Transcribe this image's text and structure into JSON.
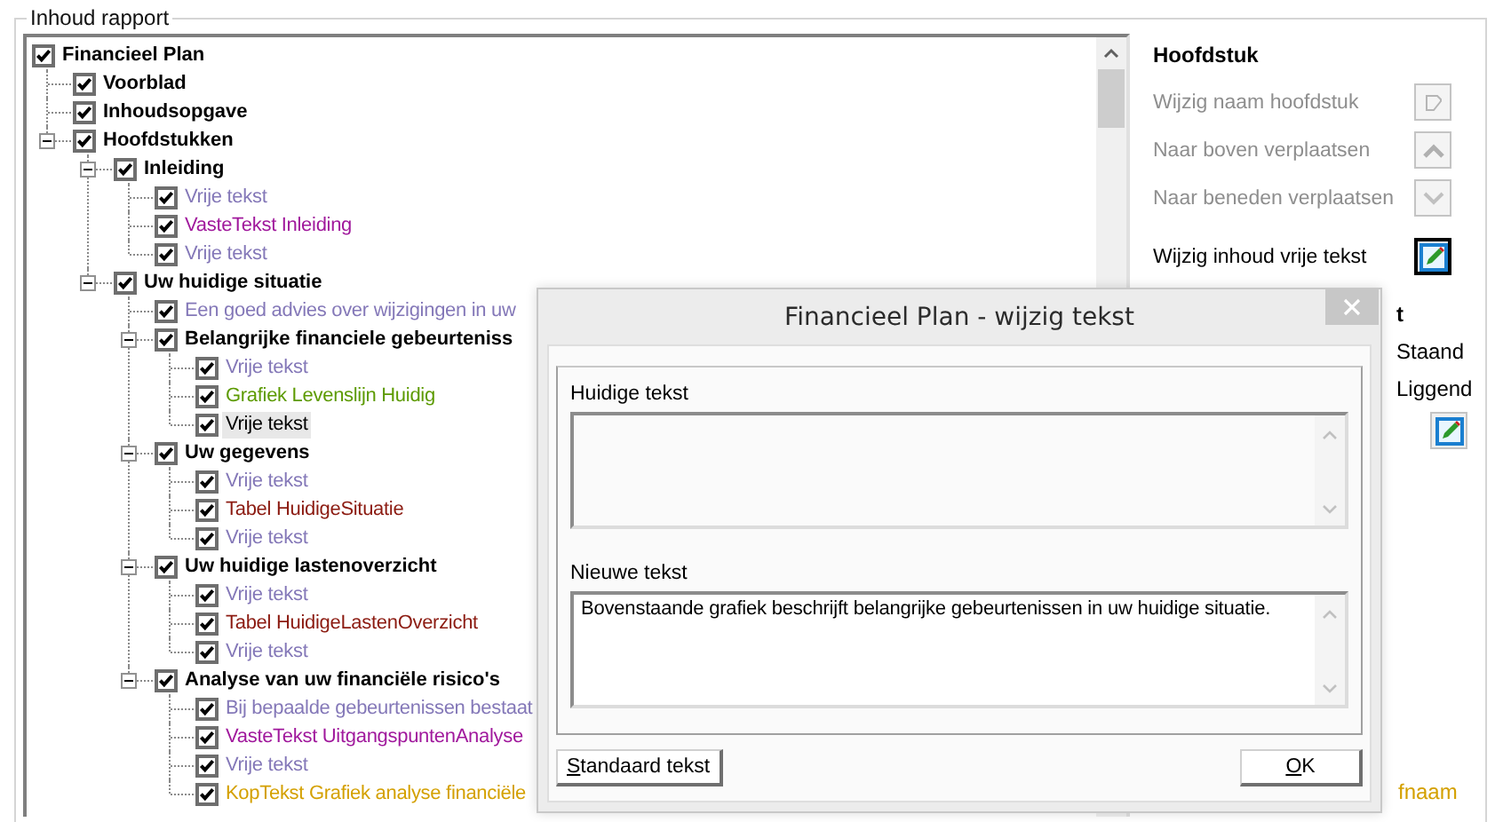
{
  "group_title": "Inhoud rapport",
  "tree": [
    {
      "label": "Financieel Plan",
      "kind": "section",
      "checked": true,
      "selected": false,
      "children": [
        {
          "label": "Voorblad",
          "kind": "section",
          "checked": true,
          "selected": false
        },
        {
          "label": "Inhoudsopgave",
          "kind": "section",
          "checked": true,
          "selected": false
        },
        {
          "label": "Hoofdstukken",
          "kind": "section",
          "checked": true,
          "selected": false,
          "expanded": true,
          "children": [
            {
              "label": "Inleiding",
              "kind": "section",
              "checked": true,
              "selected": false,
              "expanded": true,
              "children": [
                {
                  "label": "Vrije tekst",
                  "kind": "item",
                  "color": "#8478b8",
                  "checked": true,
                  "selected": false
                },
                {
                  "label": "VasteTekst Inleiding",
                  "kind": "item",
                  "color": "#a0189c",
                  "checked": true,
                  "selected": false
                },
                {
                  "label": "Vrije tekst",
                  "kind": "item",
                  "color": "#8478b8",
                  "checked": true,
                  "selected": false
                }
              ]
            },
            {
              "label": "Uw huidige situatie",
              "kind": "section",
              "checked": true,
              "selected": false,
              "expanded": true,
              "children": [
                {
                  "label": "Een goed advies over wijzigingen in uw",
                  "kind": "item",
                  "color": "#8478b8",
                  "checked": true,
                  "selected": false
                },
                {
                  "label": "Belangrijke financiele gebeurteniss",
                  "kind": "section",
                  "checked": true,
                  "selected": false,
                  "expanded": true,
                  "children": [
                    {
                      "label": "Vrije tekst",
                      "kind": "item",
                      "color": "#8478b8",
                      "checked": true,
                      "selected": false
                    },
                    {
                      "label": "Grafiek Levenslijn Huidig",
                      "kind": "item",
                      "color": "#5c9a00",
                      "checked": true,
                      "selected": false
                    },
                    {
                      "label": "Vrije tekst",
                      "kind": "item",
                      "color": "#000000",
                      "checked": true,
                      "selected": true
                    }
                  ]
                },
                {
                  "label": "Uw gegevens",
                  "kind": "section",
                  "checked": true,
                  "selected": false,
                  "expanded": true,
                  "children": [
                    {
                      "label": "Vrije tekst",
                      "kind": "item",
                      "color": "#8478b8",
                      "checked": true,
                      "selected": false
                    },
                    {
                      "label": "Tabel HuidigeSituatie",
                      "kind": "item",
                      "color": "#8b1a10",
                      "checked": true,
                      "selected": false
                    },
                    {
                      "label": "Vrije tekst",
                      "kind": "item",
                      "color": "#8478b8",
                      "checked": true,
                      "selected": false
                    }
                  ]
                },
                {
                  "label": "Uw huidige lastenoverzicht",
                  "kind": "section",
                  "checked": true,
                  "selected": false,
                  "expanded": true,
                  "children": [
                    {
                      "label": "Vrije tekst",
                      "kind": "item",
                      "color": "#8478b8",
                      "checked": true,
                      "selected": false
                    },
                    {
                      "label": "Tabel HuidigeLastenOverzicht",
                      "kind": "item",
                      "color": "#8b1a10",
                      "checked": true,
                      "selected": false
                    },
                    {
                      "label": "Vrije tekst",
                      "kind": "item",
                      "color": "#8478b8",
                      "checked": true,
                      "selected": false
                    }
                  ]
                },
                {
                  "label": "Analyse van uw financiële risico's",
                  "kind": "section",
                  "checked": true,
                  "selected": false,
                  "expanded": true,
                  "children": [
                    {
                      "label": "Bij bepaalde gebeurtenissen bestaat",
                      "kind": "item",
                      "color": "#8478b8",
                      "checked": true,
                      "selected": false
                    },
                    {
                      "label": "VasteTekst UitgangspuntenAnalyse",
                      "kind": "item",
                      "color": "#a0189c",
                      "checked": true,
                      "selected": false
                    },
                    {
                      "label": "Vrije tekst",
                      "kind": "item",
                      "color": "#8478b8",
                      "checked": true,
                      "selected": false
                    },
                    {
                      "label": "KopTekst Grafiek analyse financiële",
                      "kind": "item",
                      "color": "#d4a000",
                      "checked": true,
                      "selected": false
                    }
                  ]
                }
              ]
            }
          ]
        }
      ]
    }
  ],
  "chapter_panel": {
    "title": "Hoofdstuk",
    "actions": [
      {
        "label": "Wijzig naam hoofdstuk",
        "kind": "rename",
        "disabled": true,
        "focused": false
      },
      {
        "label": "Naar boven verplaatsen",
        "kind": "up",
        "disabled": true,
        "focused": false
      },
      {
        "label": "Naar beneden verplaatsen",
        "kind": "down",
        "disabled": true,
        "focused": false
      },
      {
        "label": "Wijzig inhoud vrije tekst",
        "kind": "edit",
        "disabled": false,
        "focused": true
      }
    ]
  },
  "layout_panel": {
    "title": "t",
    "options": [
      "Staand",
      "Liggend"
    ],
    "edit_disabled": false
  },
  "paragraph_header": "fnaam",
  "dialog": {
    "title": "Financieel Plan - wijzig tekst",
    "current_text": {
      "label": "Huidige tekst"
    },
    "new_text": {
      "label": "Nieuwe tekst",
      "value": "Bovenstaande grafiek beschrijft belangrijke gebeurtenissen in uw huidige situatie."
    },
    "buttons": [
      {
        "label": "Standaard tekst",
        "kind": "default"
      },
      {
        "label": "OK",
        "kind": "ok"
      }
    ]
  }
}
